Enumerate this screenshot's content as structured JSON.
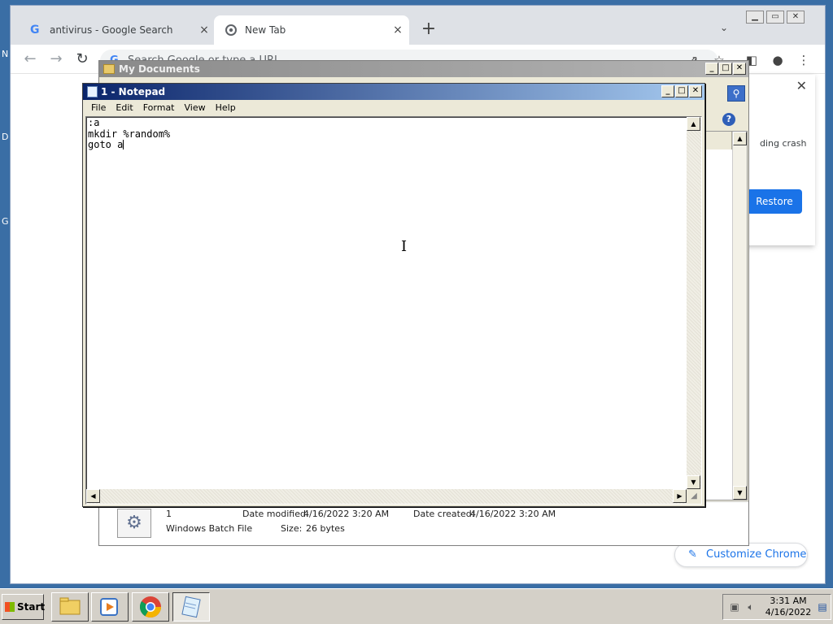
{
  "desktop": {
    "letters": [
      "N",
      "D",
      "G"
    ]
  },
  "chrome": {
    "tabs": [
      {
        "title": "antivirus - Google Search",
        "icon": "google-g-icon",
        "close": "×"
      },
      {
        "title": "New Tab",
        "icon": "chrome-logo-icon",
        "close": "×"
      }
    ],
    "new_tab": "+",
    "tab_search": "⌄",
    "window_buttons": [
      "▁",
      "▭",
      "✕"
    ],
    "toolbar": {
      "back": "←",
      "forward": "→",
      "reload": "↻",
      "more": "⋮"
    },
    "omnibox_placeholder": "Search Google or type a URL",
    "omnibox_g": "G",
    "restore_card": {
      "close": "✕",
      "text": "ding crash",
      "button": "Restore"
    },
    "customize_button": "Customize Chrome",
    "customize_icon": "✎"
  },
  "mydocs": {
    "title": "My Documents",
    "buttons": [
      "_",
      "□",
      "✕"
    ],
    "help": "?",
    "details": {
      "name": "1",
      "type": "Windows Batch File",
      "modified_label": "Date modified:",
      "modified": "4/16/2022 3:20 AM",
      "created_label": "Date created:",
      "created": "4/16/2022 3:20 AM",
      "size_label": "Size:",
      "size": "26 bytes"
    }
  },
  "notepad": {
    "title": "1 - Notepad",
    "buttons": [
      "_",
      "□",
      "✕"
    ],
    "menu": [
      "File",
      "Edit",
      "Format",
      "View",
      "Help"
    ],
    "lines": [
      ":a",
      "mkdir %random%",
      "goto a"
    ]
  },
  "taskbar": {
    "start": "Start",
    "clock_time": "3:31 AM",
    "clock_date": "4/16/2022"
  }
}
